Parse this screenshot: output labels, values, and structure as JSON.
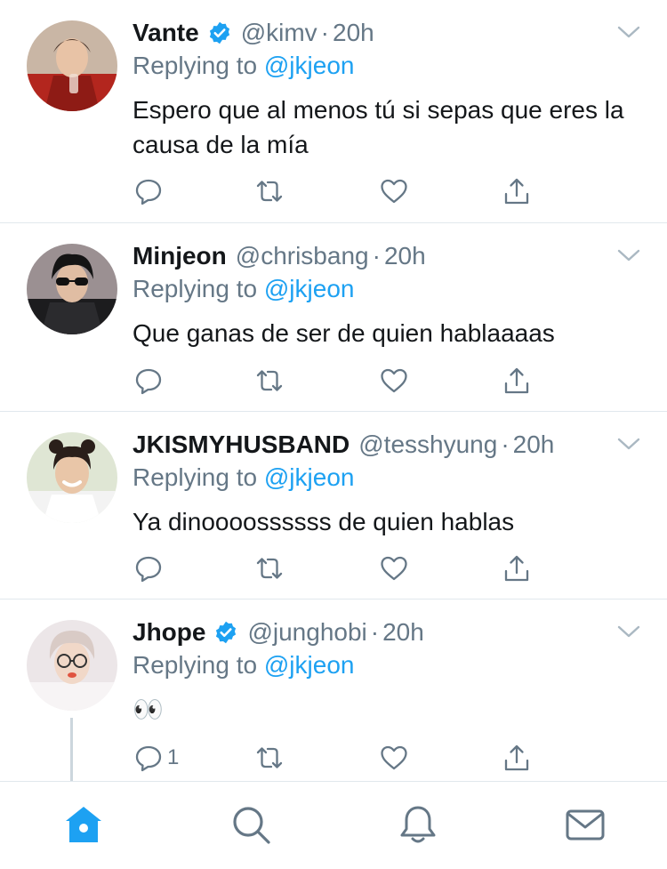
{
  "tweets": [
    {
      "name": "Vante",
      "verified": true,
      "handle": "@kimv",
      "time": "20h",
      "reply_prefix": "Replying to",
      "reply_to": "@jkjeon",
      "text": "Espero que al menos tú si sepas que eres la causa de la mía",
      "reply_count": ""
    },
    {
      "name": "Minjeon",
      "verified": false,
      "handle": "@chrisbang",
      "time": "20h",
      "reply_prefix": "Replying to",
      "reply_to": "@jkjeon",
      "text": "Que ganas de ser de quien hablaaaas",
      "reply_count": ""
    },
    {
      "name": "JKISMYHUSBAND",
      "verified": false,
      "handle": "@tesshyung",
      "time": "20h",
      "reply_prefix": "Replying to",
      "reply_to": "@jkjeon",
      "text": "Ya dinoooossssss de quien hablas",
      "reply_count": ""
    },
    {
      "name": "Jhope",
      "verified": true,
      "handle": "@junghobi",
      "time": "20h",
      "reply_prefix": "Replying to",
      "reply_to": "@jkjeon",
      "text": "👀",
      "reply_count": "1"
    }
  ],
  "tabs": [
    {
      "icon": "home-icon",
      "active": true
    },
    {
      "icon": "search-icon",
      "active": false
    },
    {
      "icon": "notifications-icon",
      "active": false
    },
    {
      "icon": "messages-icon",
      "active": false
    }
  ],
  "colors": {
    "accent": "#1da1f2",
    "text": "#14171a",
    "muted": "#657786",
    "border": "#e1e8ed"
  }
}
